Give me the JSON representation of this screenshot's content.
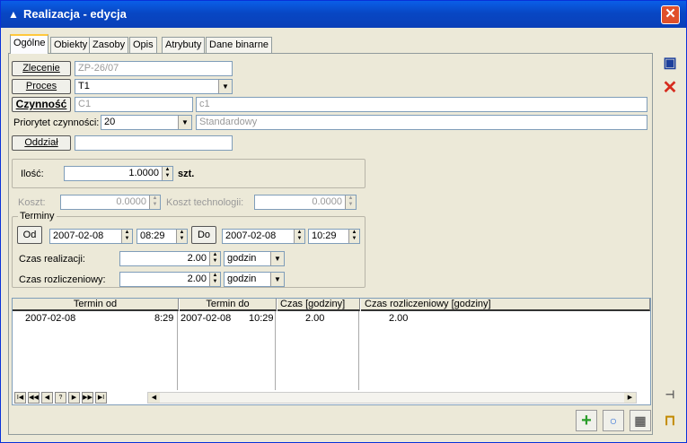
{
  "window": {
    "title": "Realizacja - edycja",
    "close_glyph": "✕"
  },
  "tabs": [
    {
      "label": "Ogólne"
    },
    {
      "label": "Obiekty"
    },
    {
      "label": "Zasoby"
    },
    {
      "label": "Opis"
    },
    {
      "label": "Atrybuty"
    },
    {
      "label": "Dane binarne"
    }
  ],
  "form": {
    "zlecenie_label": "Zlecenie",
    "zlecenie_value": "ZP-26/07",
    "proces_label": "Proces",
    "proces_value": "T1",
    "czynnosc_label": "Czynność",
    "czynnosc_code": "C1",
    "czynnosc_name": "c1",
    "priorytet_label": "Priorytet czynności:",
    "priorytet_value": "20",
    "priorytet_name": "Standardowy",
    "oddzial_label": "Oddział",
    "oddzial_value": "",
    "ilosc_label": "Ilość:",
    "ilosc_value": "1.0000",
    "ilosc_unit": "szt.",
    "koszt_label": "Koszt:",
    "koszt_value": "0.0000",
    "koszt_tech_label": "Koszt technologii:",
    "koszt_tech_value": "0.0000"
  },
  "terminy": {
    "group_label": "Terminy",
    "od_label": "Od",
    "od_date": "2007-02-08",
    "od_time": "08:29",
    "do_label": "Do",
    "do_date": "2007-02-08",
    "do_time": "10:29",
    "czas_realizacji_label": "Czas realizacji:",
    "czas_realizacji_value": "2.00",
    "czas_realizacji_unit": "godzin",
    "czas_rozl_label": "Czas rozliczeniowy:",
    "czas_rozl_value": "2.00",
    "czas_rozl_unit": "godzin"
  },
  "grid": {
    "columns": [
      "Termin od",
      "Termin do",
      "Czas [godziny]",
      "Czas rozliczeniowy [godziny]"
    ],
    "rows": [
      {
        "od_date": "2007-02-08",
        "od_time": "8:29",
        "do_date": "2007-02-08",
        "do_time": "10:29",
        "czas": "2.00",
        "czas_rozl": "2.00"
      }
    ],
    "nav": [
      "I◀",
      "◀◀",
      "◀",
      "?",
      "▶",
      "▶▶",
      "▶I"
    ]
  }
}
